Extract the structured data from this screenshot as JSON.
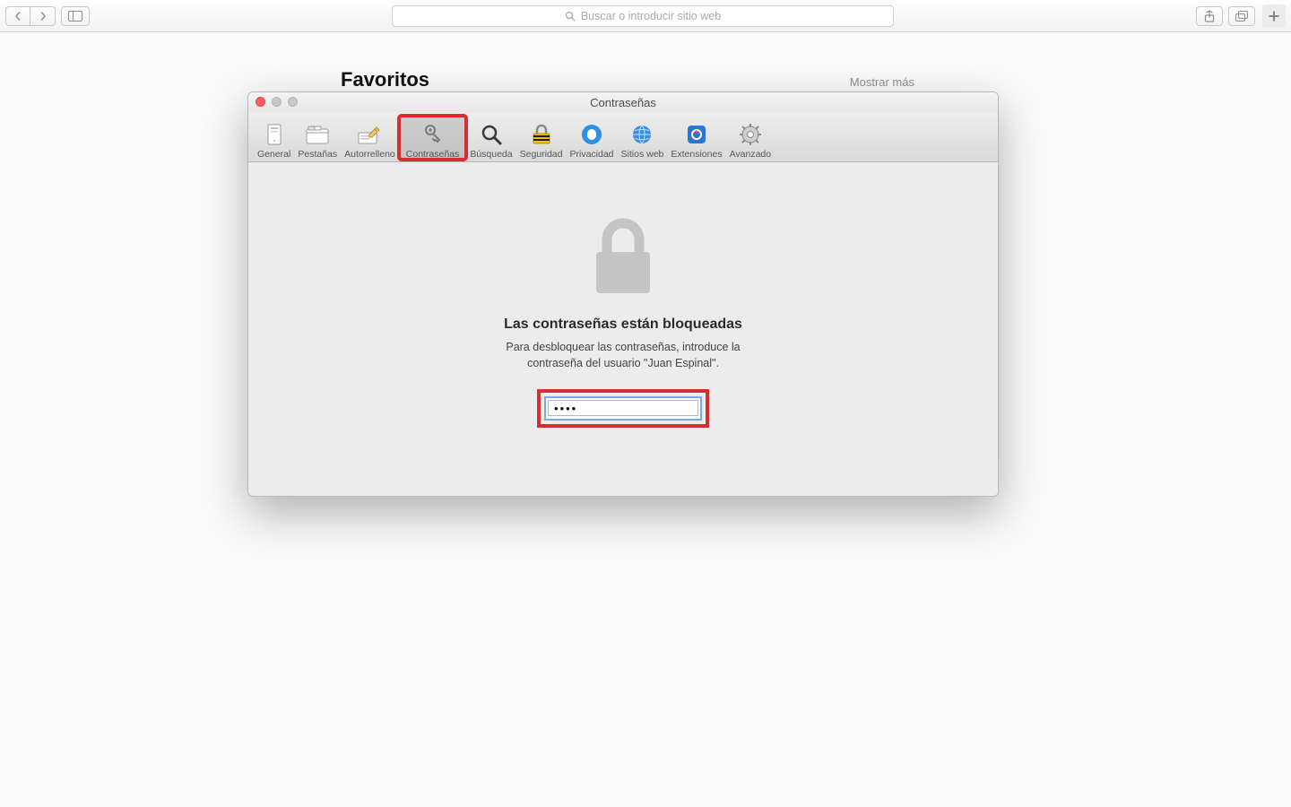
{
  "browser": {
    "address_placeholder": "Buscar o introducir sitio web"
  },
  "page": {
    "favorites_title": "Favoritos",
    "show_more": "Mostrar más"
  },
  "prefs": {
    "window_title": "Contraseñas",
    "toolbar": [
      {
        "id": "general",
        "label": "General"
      },
      {
        "id": "pestanas",
        "label": "Pestañas"
      },
      {
        "id": "autorrelleno",
        "label": "Autorrelleno"
      },
      {
        "id": "contrasenas",
        "label": "Contraseñas"
      },
      {
        "id": "busqueda",
        "label": "Búsqueda"
      },
      {
        "id": "seguridad",
        "label": "Seguridad"
      },
      {
        "id": "privacidad",
        "label": "Privacidad"
      },
      {
        "id": "sitiosweb",
        "label": "Sitios web"
      },
      {
        "id": "extensiones",
        "label": "Extensiones"
      },
      {
        "id": "avanzado",
        "label": "Avanzado"
      }
    ],
    "selected_tab": "contrasenas",
    "locked": {
      "title": "Las contraseñas están bloqueadas",
      "subtitle": "Para desbloquear las contraseñas, introduce la contraseña del usuario \"Juan Espinal\".",
      "password_value": "••••"
    }
  }
}
